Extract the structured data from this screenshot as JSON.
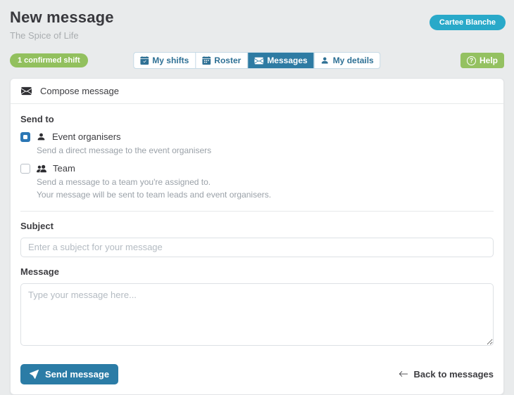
{
  "page": {
    "title": "New message",
    "subtitle": "The Spice of Life",
    "org_button_label": "Cartee Blanche",
    "shift_badge": "1 confirmed shift",
    "help_label": "Help"
  },
  "tabs": [
    {
      "label": "My shifts",
      "icon": "calendar-check-icon",
      "active": false
    },
    {
      "label": "Roster",
      "icon": "calendar-icon",
      "active": false
    },
    {
      "label": "Messages",
      "icon": "envelope-icon",
      "active": true
    },
    {
      "label": "My details",
      "icon": "person-icon",
      "active": false
    }
  ],
  "compose": {
    "header": "Compose message",
    "send_to": {
      "label": "Send to",
      "options": [
        {
          "label": "Event organisers",
          "checked": true,
          "icon": "person-icon",
          "descriptions": [
            "Send a direct message to the event organisers"
          ]
        },
        {
          "label": "Team",
          "checked": false,
          "icon": "people-icon",
          "descriptions": [
            "Send a message to a team you're assigned to.",
            "Your message will be sent to team leads and event organisers."
          ]
        }
      ]
    },
    "subject": {
      "label": "Subject",
      "placeholder": "Enter a subject for your message",
      "value": ""
    },
    "message": {
      "label": "Message",
      "placeholder": "Type your message here...",
      "value": ""
    },
    "footer": {
      "send_label": "Send message",
      "back_label": "Back to messages",
      "back_arrow": "←"
    }
  },
  "colors": {
    "page_background": "#e9ebec",
    "accent_teal": "#29a9c9",
    "accent_green": "#92c05e",
    "tab_active_blue": "#2e7ba3",
    "tab_text_blue": "#2f7195",
    "send_button_blue": "#2b7ca6",
    "checkbox_blue": "#2b77b5",
    "muted_text": "#9aa1a8"
  }
}
